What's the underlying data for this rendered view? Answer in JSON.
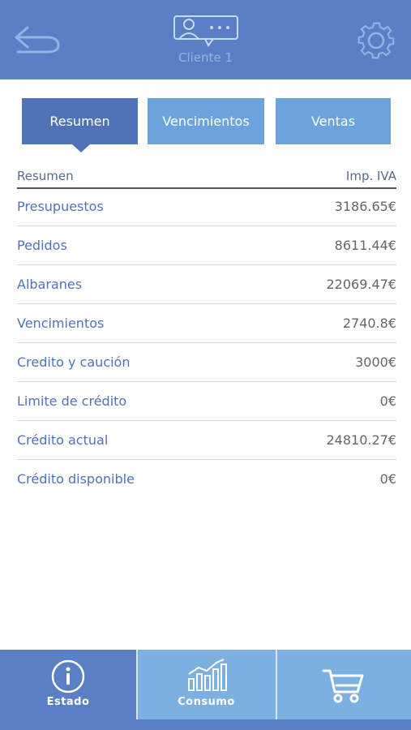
{
  "header": {
    "client_name": "Cliente 1",
    "back_icon": "back-arrow-icon",
    "client_icon": "client-chat-icon",
    "settings_icon": "gear-icon"
  },
  "tabs": [
    {
      "label": "Resumen",
      "active": true
    },
    {
      "label": "Vencimientos",
      "active": false
    },
    {
      "label": "Ventas",
      "active": false
    }
  ],
  "table": {
    "header_left": "Resumen",
    "header_right": "Imp. IVA",
    "rows": [
      {
        "label": "Presupuestos",
        "value": "3186.65€"
      },
      {
        "label": "Pedidos",
        "value": "8611.44€"
      },
      {
        "label": "Albaranes",
        "value": "22069.47€"
      },
      {
        "label": "Vencimientos",
        "value": "2740.8€"
      },
      {
        "label": "Credito y caución",
        "value": "3000€"
      },
      {
        "label": "Limite de crédito",
        "value": "0€"
      },
      {
        "label": "Crédito actual",
        "value": "24810.27€"
      },
      {
        "label": "Crédito disponible",
        "value": "0€"
      }
    ]
  },
  "bottom_nav": [
    {
      "label": "Estado",
      "icon": "info-icon",
      "active": true
    },
    {
      "label": "Consumo",
      "icon": "bar-chart-icon",
      "active": false
    },
    {
      "label": "",
      "icon": "cart-icon",
      "active": false
    }
  ],
  "colors": {
    "primary": "#5a7fc4",
    "active_tab": "#4f73b6",
    "inactive_tab": "#6ba3dc",
    "bottom_bar": "#7cb0e0"
  }
}
